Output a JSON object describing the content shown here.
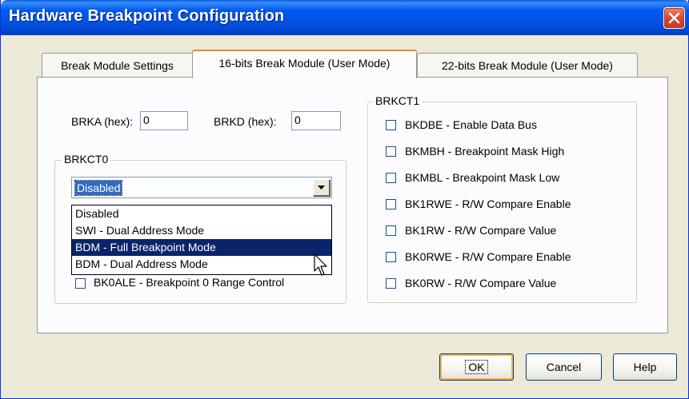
{
  "window": {
    "title": "Hardware Breakpoint Configuration"
  },
  "tabs": [
    {
      "label": "Break Module Settings",
      "active": false
    },
    {
      "label": "16-bits Break Module (User Mode)",
      "active": true
    },
    {
      "label": "22-bits Break Module (User Mode)",
      "active": false
    }
  ],
  "fields": {
    "brka_label": "BRKA (hex):",
    "brka_value": "0",
    "brkd_label": "BRKD (hex):",
    "brkd_value": "0"
  },
  "brkct0": {
    "title": "BRKCT0",
    "selected": "Disabled",
    "options": [
      {
        "label": "Disabled"
      },
      {
        "label": "SWI - Dual Address Mode"
      },
      {
        "label": "BDM - Full Breakpoint Mode",
        "highlighted": true
      },
      {
        "label": "BDM - Dual Address Mode"
      }
    ],
    "partial_checkbox_label": "BK0ALE - Breakpoint 0 Range Control"
  },
  "brkct1": {
    "title": "BRKCT1",
    "checkboxes": [
      {
        "label": "BKDBE - Enable Data Bus",
        "checked": false
      },
      {
        "label": "BKMBH - Breakpoint Mask High",
        "checked": false
      },
      {
        "label": "BKMBL - Breakpoint Mask Low",
        "checked": false
      },
      {
        "label": "BK1RWE - R/W Compare Enable",
        "checked": false
      },
      {
        "label": "BK1RW - R/W Compare Value",
        "checked": false
      },
      {
        "label": "BK0RWE - R/W Compare Enable",
        "checked": false
      },
      {
        "label": "BK0RW - R/W Compare Value",
        "checked": false
      }
    ]
  },
  "buttons": {
    "ok": "OK",
    "cancel": "Cancel",
    "help": "Help"
  },
  "colors": {
    "titlebar": "#0055e5",
    "selection": "#0a246a",
    "close_button": "#d6472b",
    "tab_active_accent": "#e68b2c"
  }
}
